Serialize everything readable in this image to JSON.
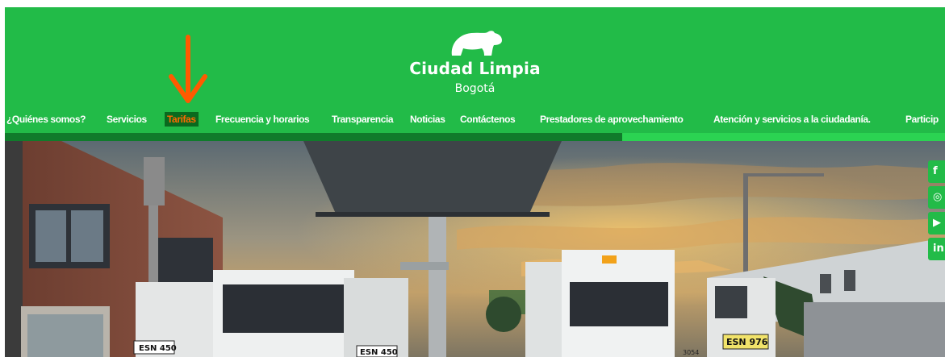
{
  "logo": {
    "title": "Ciudad Limpia",
    "subtitle": "Bogotá"
  },
  "nav": {
    "items": [
      {
        "label": "¿Quiénes somos?"
      },
      {
        "label": "Servicios"
      },
      {
        "label": "Tarifas",
        "active": true
      },
      {
        "label": "Frecuencia y horarios"
      },
      {
        "label": "Transparencia"
      },
      {
        "label": "Noticias"
      },
      {
        "label": "Contáctenos"
      },
      {
        "label": "Prestadores de aprovechamiento"
      },
      {
        "label": "Atención y servicios a la ciudadanía."
      },
      {
        "label": "Particip"
      }
    ]
  },
  "annotation": {
    "icon": "arrow-down-icon",
    "color": "#ff5a00"
  },
  "hero": {
    "plates": [
      "ESN 450",
      "ESN 450",
      "ESN 976"
    ],
    "truck_number": "3054"
  },
  "social": [
    {
      "icon": "facebook-icon",
      "glyph": "f"
    },
    {
      "icon": "instagram-icon",
      "glyph": "◎"
    },
    {
      "icon": "youtube-icon",
      "glyph": "▶"
    },
    {
      "icon": "linkedin-icon",
      "glyph": "in"
    }
  ],
  "colors": {
    "brand_green": "#22bb48",
    "nav_active_bg": "#0a6a1e",
    "nav_active_text": "#ff6a00",
    "divider_dark": "#107b2b",
    "divider_light": "#2bd352"
  }
}
